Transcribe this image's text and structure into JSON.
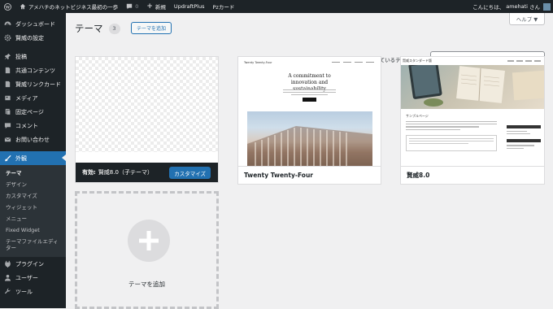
{
  "adminbar": {
    "site_name": "アメハチのネットビジネス最初の一歩",
    "comments_count": "0",
    "new_label": "新規",
    "updraft_label": "UpdraftPlus",
    "pz_label": "Pzカード",
    "greeting": "こんにちは、",
    "username": "amehati",
    "san": "さん"
  },
  "sidebar": {
    "items": [
      {
        "label": "ダッシュボード"
      },
      {
        "label": "賢威の設定"
      },
      {
        "label": "投稿"
      },
      {
        "label": "共通コンテンツ"
      },
      {
        "label": "賢威リンクカード"
      },
      {
        "label": "メディア"
      },
      {
        "label": "固定ページ"
      },
      {
        "label": "コメント"
      },
      {
        "label": "お問い合わせ"
      },
      {
        "label": "外観"
      },
      {
        "label": "プラグイン"
      },
      {
        "label": "ユーザー"
      },
      {
        "label": "ツール"
      }
    ],
    "submenu": [
      "テーマ",
      "デザイン",
      "カスタマイズ",
      "ウィジェット",
      "メニュー",
      "Fixed Widget",
      "テーマファイルエディター"
    ]
  },
  "header": {
    "help_label": "ヘルプ ▼",
    "title": "テーマ",
    "count": "3",
    "add_button": "テーマを追加",
    "search_label": "インストールされているテーマを検索",
    "search_value": ""
  },
  "themes": {
    "active_prefix": "有効:",
    "active_name": "賢威8.0（子テーマ）",
    "customize_label": "カスタマイズ",
    "theme2_name": "Twenty Twenty-Four",
    "theme3_name": "賢威8.0",
    "add_theme_label": "テーマを追加"
  },
  "thumb_tt4": {
    "site": "Twenty Twenty-Four",
    "headline": "A commitment to innovation and sustainability"
  },
  "thumb_keni": {
    "brand": "賢威スタンダード版",
    "page_label": "サンプルページ"
  },
  "colors": {
    "admin_dark": "#1d2327",
    "accent": "#2271b1",
    "background": "#f0f0f1"
  }
}
